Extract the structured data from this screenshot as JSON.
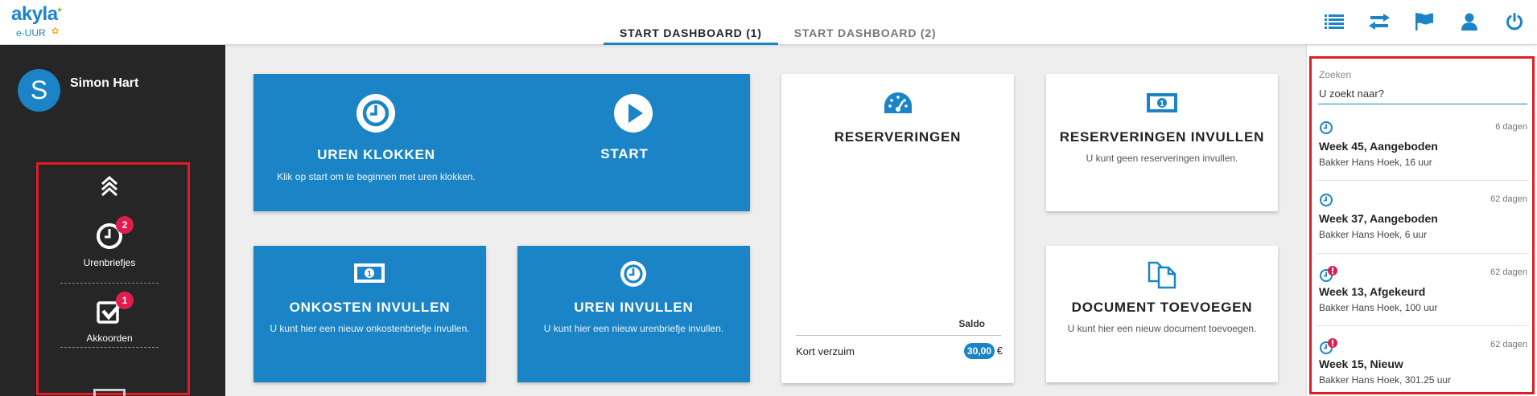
{
  "logo": {
    "brand": "akyla",
    "sub": "e-UUR"
  },
  "tabs": [
    {
      "label": "START DASHBOARD (1)",
      "active": true
    },
    {
      "label": "START DASHBOARD (2)",
      "active": false
    }
  ],
  "toolbar_icons": [
    "list-icon",
    "swap-icon",
    "flag-icon",
    "user-icon",
    "power-icon"
  ],
  "colors": {
    "accent": "#1a84c7",
    "sidebar": "#262626",
    "badge": "#e31c4e",
    "highlight": "#e31b23"
  },
  "user": {
    "initial": "S",
    "name": "Simon Hart"
  },
  "sidebar": {
    "items": [
      {
        "label": "Urenbriefjes",
        "badge": "2",
        "icon": "clock-icon"
      },
      {
        "label": "Akkoorden",
        "badge": "1",
        "icon": "checkbox-icon"
      }
    ]
  },
  "cards": {
    "uren_klokken": {
      "title": "UREN KLOKKEN",
      "desc": "Klik op start om te beginnen met uren klokken."
    },
    "start": {
      "title": "START"
    },
    "reserveringen": {
      "title": "RESERVERINGEN",
      "saldo_header": "Saldo",
      "rows": [
        {
          "label": "Kort verzuim",
          "value": "30,00",
          "unit": "€"
        }
      ]
    },
    "reserveringen_invullen": {
      "title": "RESERVERINGEN INVULLEN",
      "desc": "U kunt geen reserveringen invullen."
    },
    "onkosten_invullen": {
      "title": "ONKOSTEN INVULLEN",
      "desc": "U kunt hier een nieuw onkostenbriefje invullen."
    },
    "uren_invullen": {
      "title": "UREN INVULLEN",
      "desc": "U kunt hier een nieuw urenbriefje invullen."
    },
    "document_toevoegen": {
      "title": "DOCUMENT TOEVOEGEN",
      "desc": "U kunt hier een nieuw document toevoegen."
    }
  },
  "search": {
    "label": "Zoeken",
    "placeholder": "U zoekt naar?"
  },
  "recent": [
    {
      "days": "6 dagen",
      "title": "Week 45, Aangeboden",
      "sub": "Bakker Hans Hoek, 16 uur",
      "alert": false
    },
    {
      "days": "62 dagen",
      "title": "Week 37, Aangeboden",
      "sub": "Bakker Hans Hoek, 6 uur",
      "alert": false
    },
    {
      "days": "62 dagen",
      "title": "Week 13, Afgekeurd",
      "sub": "Bakker Hans Hoek, 100 uur",
      "alert": true
    },
    {
      "days": "62 dagen",
      "title": "Week 15, Nieuw",
      "sub": "Bakker Hans Hoek, 301.25 uur",
      "alert": true
    }
  ]
}
